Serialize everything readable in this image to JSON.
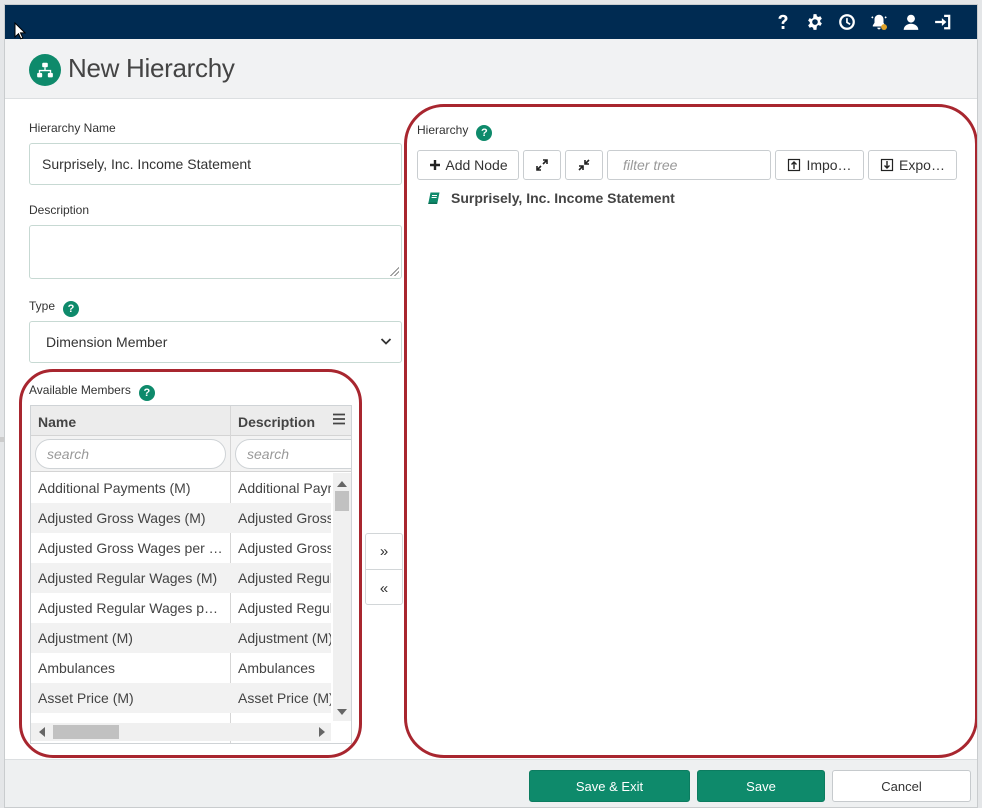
{
  "header": {
    "title": "New Hierarchy"
  },
  "topbar": {
    "icons": [
      "help-icon",
      "gear-icon",
      "clock-icon",
      "notification-bell-icon",
      "user-icon",
      "logout-icon"
    ]
  },
  "form": {
    "hierarchy_name_label": "Hierarchy Name",
    "hierarchy_name_value": "Surprisely, Inc. Income Statement",
    "description_label": "Description",
    "description_value": "",
    "type_label": "Type",
    "type_value": "Dimension Member",
    "available_members_label": "Available Members"
  },
  "grid": {
    "columns": [
      "Name",
      "Description"
    ],
    "search_placeholder_name": "search",
    "search_placeholder_desc": "search",
    "rows": [
      {
        "name": "Additional Payments (M)",
        "description": "Additional Payments (M)"
      },
      {
        "name": "Adjusted Gross Wages (M)",
        "description": "Adjusted Gross Wages (M)"
      },
      {
        "name": "Adjusted Gross Wages per Employee (M)",
        "description": "Adjusted Gross Wages per Employee (M)"
      },
      {
        "name": "Adjusted Regular Wages (M)",
        "description": "Adjusted Regular Wages (M)"
      },
      {
        "name": "Adjusted Regular Wages per Employee (M)",
        "description": "Adjusted Regular Wages per Employee (M)"
      },
      {
        "name": "Adjustment (M)",
        "description": "Adjustment (M)"
      },
      {
        "name": "Ambulances",
        "description": "Ambulances"
      },
      {
        "name": "Asset Price (M)",
        "description": "Asset Price (M)"
      }
    ]
  },
  "move_buttons": {
    "add": "»",
    "remove": "«"
  },
  "hierarchy": {
    "label": "Hierarchy",
    "add_node": "Add Node",
    "filter_placeholder": "filter tree",
    "import": "Impo…",
    "export": "Expo…",
    "root": "Surprisely, Inc. Income Statement"
  },
  "footer": {
    "save_exit": "Save & Exit",
    "save": "Save",
    "cancel": "Cancel"
  },
  "colors": {
    "topbar": "#002b52",
    "primary": "#0e8a6b",
    "highlight_ring": "#a8262f"
  }
}
